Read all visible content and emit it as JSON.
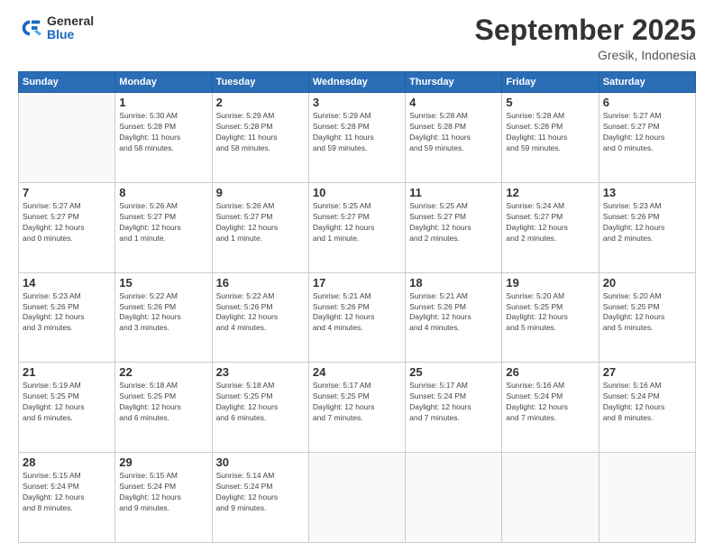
{
  "header": {
    "logo_general": "General",
    "logo_blue": "Blue",
    "month_title": "September 2025",
    "location": "Gresik, Indonesia"
  },
  "weekdays": [
    "Sunday",
    "Monday",
    "Tuesday",
    "Wednesday",
    "Thursday",
    "Friday",
    "Saturday"
  ],
  "weeks": [
    [
      {
        "day": "",
        "info": ""
      },
      {
        "day": "1",
        "info": "Sunrise: 5:30 AM\nSunset: 5:28 PM\nDaylight: 11 hours\nand 58 minutes."
      },
      {
        "day": "2",
        "info": "Sunrise: 5:29 AM\nSunset: 5:28 PM\nDaylight: 11 hours\nand 58 minutes."
      },
      {
        "day": "3",
        "info": "Sunrise: 5:29 AM\nSunset: 5:28 PM\nDaylight: 11 hours\nand 59 minutes."
      },
      {
        "day": "4",
        "info": "Sunrise: 5:28 AM\nSunset: 5:28 PM\nDaylight: 11 hours\nand 59 minutes."
      },
      {
        "day": "5",
        "info": "Sunrise: 5:28 AM\nSunset: 5:28 PM\nDaylight: 11 hours\nand 59 minutes."
      },
      {
        "day": "6",
        "info": "Sunrise: 5:27 AM\nSunset: 5:27 PM\nDaylight: 12 hours\nand 0 minutes."
      }
    ],
    [
      {
        "day": "7",
        "info": "Sunrise: 5:27 AM\nSunset: 5:27 PM\nDaylight: 12 hours\nand 0 minutes."
      },
      {
        "day": "8",
        "info": "Sunrise: 5:26 AM\nSunset: 5:27 PM\nDaylight: 12 hours\nand 1 minute."
      },
      {
        "day": "9",
        "info": "Sunrise: 5:26 AM\nSunset: 5:27 PM\nDaylight: 12 hours\nand 1 minute."
      },
      {
        "day": "10",
        "info": "Sunrise: 5:25 AM\nSunset: 5:27 PM\nDaylight: 12 hours\nand 1 minute."
      },
      {
        "day": "11",
        "info": "Sunrise: 5:25 AM\nSunset: 5:27 PM\nDaylight: 12 hours\nand 2 minutes."
      },
      {
        "day": "12",
        "info": "Sunrise: 5:24 AM\nSunset: 5:27 PM\nDaylight: 12 hours\nand 2 minutes."
      },
      {
        "day": "13",
        "info": "Sunrise: 5:23 AM\nSunset: 5:26 PM\nDaylight: 12 hours\nand 2 minutes."
      }
    ],
    [
      {
        "day": "14",
        "info": "Sunrise: 5:23 AM\nSunset: 5:26 PM\nDaylight: 12 hours\nand 3 minutes."
      },
      {
        "day": "15",
        "info": "Sunrise: 5:22 AM\nSunset: 5:26 PM\nDaylight: 12 hours\nand 3 minutes."
      },
      {
        "day": "16",
        "info": "Sunrise: 5:22 AM\nSunset: 5:26 PM\nDaylight: 12 hours\nand 4 minutes."
      },
      {
        "day": "17",
        "info": "Sunrise: 5:21 AM\nSunset: 5:26 PM\nDaylight: 12 hours\nand 4 minutes."
      },
      {
        "day": "18",
        "info": "Sunrise: 5:21 AM\nSunset: 5:26 PM\nDaylight: 12 hours\nand 4 minutes."
      },
      {
        "day": "19",
        "info": "Sunrise: 5:20 AM\nSunset: 5:25 PM\nDaylight: 12 hours\nand 5 minutes."
      },
      {
        "day": "20",
        "info": "Sunrise: 5:20 AM\nSunset: 5:25 PM\nDaylight: 12 hours\nand 5 minutes."
      }
    ],
    [
      {
        "day": "21",
        "info": "Sunrise: 5:19 AM\nSunset: 5:25 PM\nDaylight: 12 hours\nand 6 minutes."
      },
      {
        "day": "22",
        "info": "Sunrise: 5:18 AM\nSunset: 5:25 PM\nDaylight: 12 hours\nand 6 minutes."
      },
      {
        "day": "23",
        "info": "Sunrise: 5:18 AM\nSunset: 5:25 PM\nDaylight: 12 hours\nand 6 minutes."
      },
      {
        "day": "24",
        "info": "Sunrise: 5:17 AM\nSunset: 5:25 PM\nDaylight: 12 hours\nand 7 minutes."
      },
      {
        "day": "25",
        "info": "Sunrise: 5:17 AM\nSunset: 5:24 PM\nDaylight: 12 hours\nand 7 minutes."
      },
      {
        "day": "26",
        "info": "Sunrise: 5:16 AM\nSunset: 5:24 PM\nDaylight: 12 hours\nand 7 minutes."
      },
      {
        "day": "27",
        "info": "Sunrise: 5:16 AM\nSunset: 5:24 PM\nDaylight: 12 hours\nand 8 minutes."
      }
    ],
    [
      {
        "day": "28",
        "info": "Sunrise: 5:15 AM\nSunset: 5:24 PM\nDaylight: 12 hours\nand 8 minutes."
      },
      {
        "day": "29",
        "info": "Sunrise: 5:15 AM\nSunset: 5:24 PM\nDaylight: 12 hours\nand 9 minutes."
      },
      {
        "day": "30",
        "info": "Sunrise: 5:14 AM\nSunset: 5:24 PM\nDaylight: 12 hours\nand 9 minutes."
      },
      {
        "day": "",
        "info": ""
      },
      {
        "day": "",
        "info": ""
      },
      {
        "day": "",
        "info": ""
      },
      {
        "day": "",
        "info": ""
      }
    ]
  ]
}
